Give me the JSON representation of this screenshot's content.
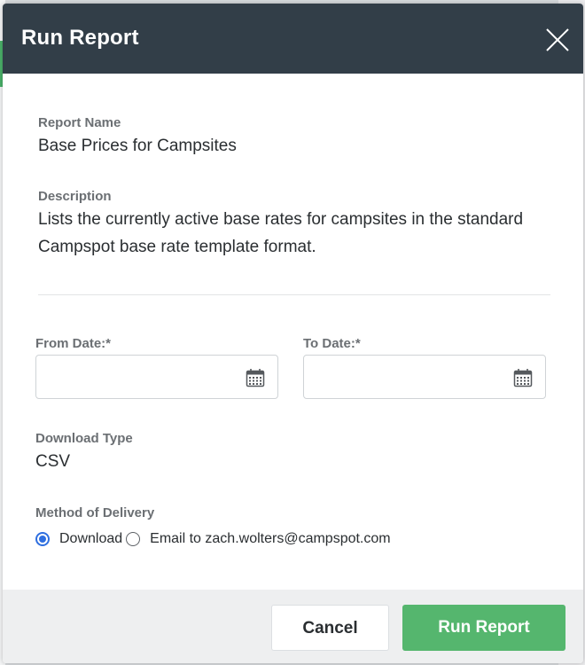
{
  "modal": {
    "title": "Run Report",
    "close_icon": "close-icon"
  },
  "report": {
    "name_label": "Report Name",
    "name_value": "Base Prices for Campsites",
    "description_label": "Description",
    "description_value": "Lists the currently active base rates for campsites in the standard Campspot base rate template format."
  },
  "dates": {
    "from_label": "From Date:*",
    "from_value": "",
    "to_label": "To Date:*",
    "to_value": "",
    "icon": "calendar-icon"
  },
  "download": {
    "label": "Download Type",
    "value": "CSV"
  },
  "delivery": {
    "label": "Method of Delivery",
    "options": [
      {
        "label": "Download",
        "selected": true
      },
      {
        "label": "Email to zach.wolters@campspot.com",
        "selected": false
      }
    ]
  },
  "footer": {
    "cancel_label": "Cancel",
    "run_label": "Run Report"
  },
  "colors": {
    "header_bg": "#323e48",
    "primary_button": "#55b66e",
    "radio_selected": "#2f6fe0"
  }
}
